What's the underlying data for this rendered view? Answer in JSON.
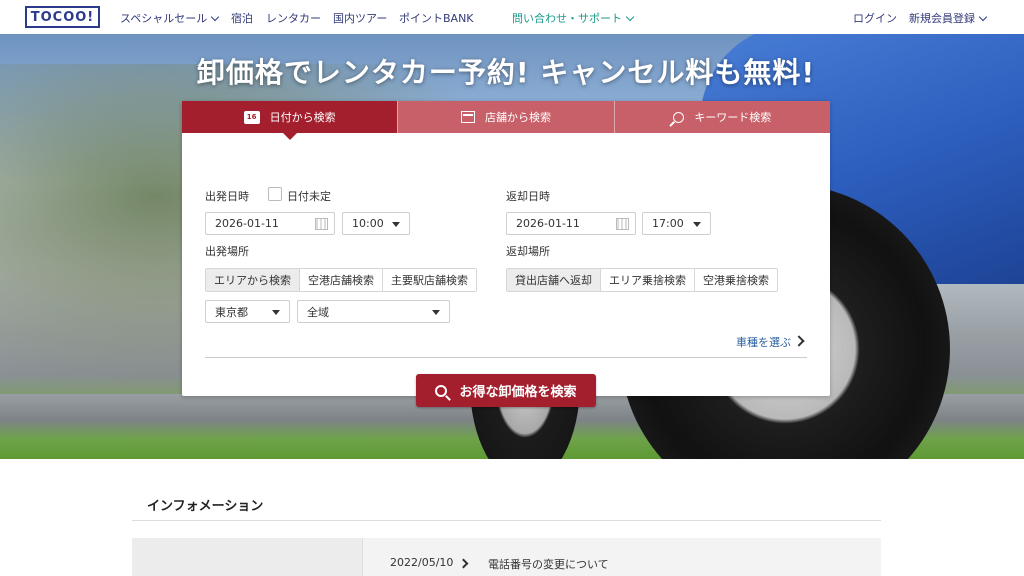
{
  "header": {
    "logo": "TOCOO!",
    "nav": [
      {
        "label": "スペシャルセール",
        "dropdown": true
      },
      {
        "label": "宿泊"
      },
      {
        "label": "レンタカー"
      },
      {
        "label": "国内ツアー"
      },
      {
        "label": "ポイントBANK"
      }
    ],
    "support": "問い合わせ・サポート",
    "login": "ログイン",
    "register": "新規会員登録"
  },
  "hero": {
    "title": "卸価格でレンタカー予約! キャンセル料も無料!"
  },
  "search": {
    "tabs": [
      {
        "label": "日付から検索",
        "active": true,
        "icon": "calendar-icon",
        "icon_text": "16"
      },
      {
        "label": "店舗から検索",
        "active": false,
        "icon": "store-icon"
      },
      {
        "label": "キーワード検索",
        "active": false,
        "icon": "search-icon"
      }
    ],
    "departure_label": "出発日時",
    "date_undecided": "日付未定",
    "departure_date": "2026-01-11",
    "departure_time": "10:00",
    "return_label": "返却日時",
    "return_date": "2026-01-11",
    "return_time": "17:00",
    "departure_place_label": "出発場所",
    "departure_place_options": [
      "エリアから検索",
      "空港店舗検索",
      "主要駅店舗検索"
    ],
    "prefecture": "東京都",
    "area": "全域",
    "return_place_label": "返却場所",
    "return_place_options": [
      "貸出店舗へ返却",
      "エリア乗捨検索",
      "空港乗捨検索"
    ],
    "choose_car": "車種を選ぶ",
    "submit": "お得な卸価格を検索"
  },
  "info": {
    "title": "インフォメーション",
    "items": [
      {
        "date": "2022/05/10",
        "text": "電話番号の変更について"
      }
    ]
  },
  "colors": {
    "brand_red": "#a31f2e",
    "tab_inactive": "#c8606a",
    "nav_blue": "#333b7a",
    "support_teal": "#1a9a8a",
    "link_blue": "#2b5f9e"
  }
}
